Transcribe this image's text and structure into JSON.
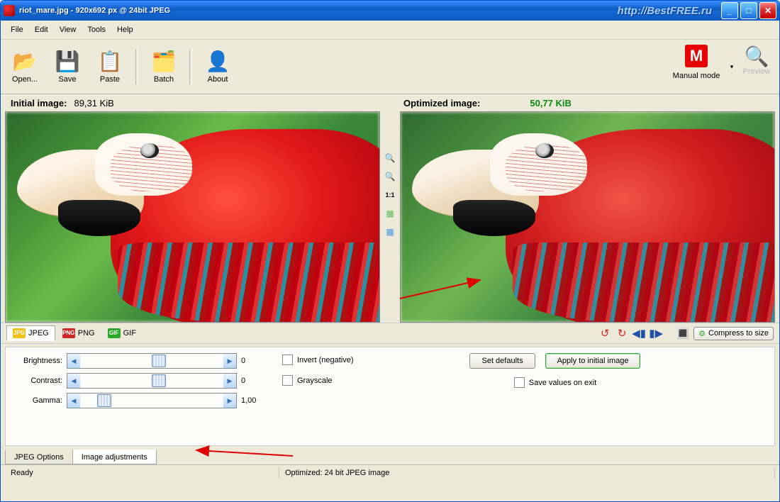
{
  "title": "riot_mare.jpg - 920x692 px @ 24bit JPEG",
  "watermark": "http://BestFREE.ru",
  "menu": {
    "file": "File",
    "edit": "Edit",
    "view": "View",
    "tools": "Tools",
    "help": "Help"
  },
  "toolbar": {
    "open": "Open...",
    "save": "Save",
    "paste": "Paste",
    "batch": "Batch",
    "about": "About",
    "manual": "Manual mode",
    "preview": "Preview"
  },
  "info": {
    "initLbl": "Initial image:",
    "initSize": "89,31 KiB",
    "optLbl": "Optimized image:",
    "optSize": "50,77 KiB"
  },
  "mid": {
    "zoomin": "+",
    "zoomout": "−",
    "one": "1:1",
    "fit": "▥",
    "pan": "▥"
  },
  "fmt": {
    "jpeg": "JPEG",
    "png": "PNG",
    "gif": "GIF",
    "compress": "Compress to size"
  },
  "adj": {
    "brightLbl": "Brightness:",
    "brightVal": "0",
    "contrastLbl": "Contrast:",
    "contrastVal": "0",
    "gammaLbl": "Gamma:",
    "gammaVal": "1,00",
    "invert": "Invert (negative)",
    "gray": "Grayscale",
    "defaults": "Set defaults",
    "apply": "Apply to initial image",
    "saveExit": "Save values on exit"
  },
  "tabs": {
    "jpegOpt": "JPEG Options",
    "imgAdj": "Image adjustments"
  },
  "status": {
    "ready": "Ready",
    "opt": "Optimized: 24 bit JPEG image"
  }
}
